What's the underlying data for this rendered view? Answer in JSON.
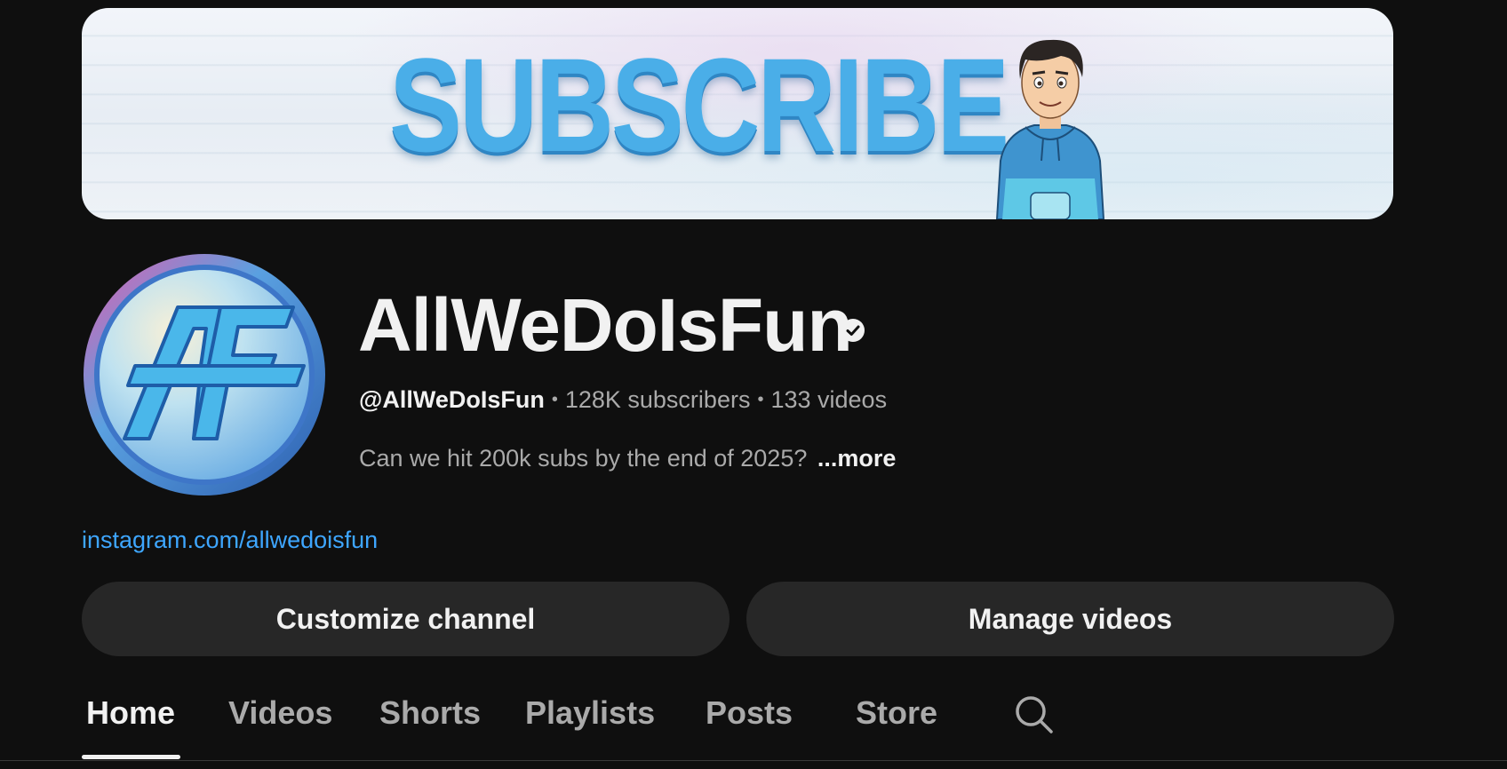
{
  "banner": {
    "text": "SUBSCRIBE",
    "colors": {
      "text": "#4aaee8",
      "background": "#eef2f7"
    }
  },
  "channel": {
    "name": "AllWeDoIsFun",
    "verified_icon": "verified-check-icon",
    "handle": "@AllWeDoIsFun",
    "subscribers": "128K subscribers",
    "videos": "133 videos",
    "separator": "•",
    "description": "Can we hit 200k subs by the end of 2025?",
    "more_label": "...more",
    "link": "instagram.com/allwedoisfun"
  },
  "actions": {
    "customize_label": "Customize channel",
    "manage_label": "Manage videos"
  },
  "tabs": [
    {
      "label": "Home",
      "active": true
    },
    {
      "label": "Videos",
      "active": false
    },
    {
      "label": "Shorts",
      "active": false
    },
    {
      "label": "Playlists",
      "active": false
    },
    {
      "label": "Posts",
      "active": false
    },
    {
      "label": "Store",
      "active": false
    }
  ],
  "tabs_search_icon": "search-icon",
  "theme": {
    "background": "#0f0f0f",
    "primary_text": "#f1f1f1",
    "secondary_text": "#aaaaaa",
    "link": "#3ea6ff",
    "button_bg": "#272727"
  }
}
